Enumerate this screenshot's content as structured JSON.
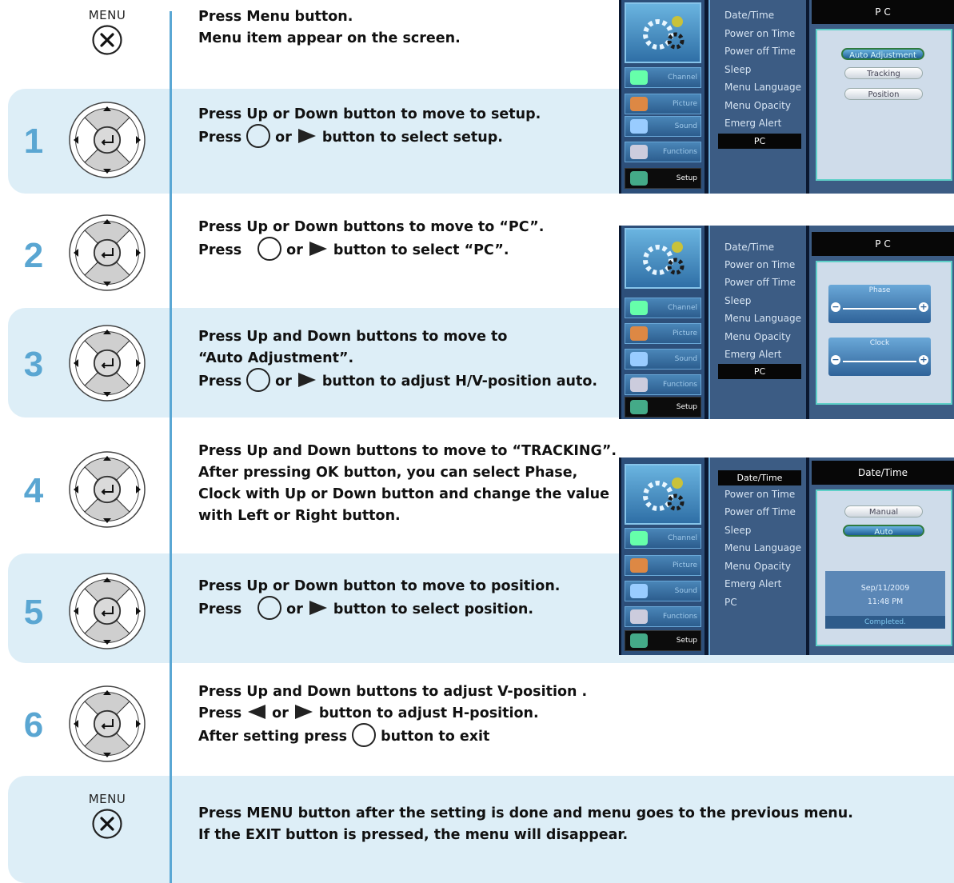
{
  "menu_label": "MENU",
  "intro": {
    "line1": "Press Menu button.",
    "line2": "Menu item appear on the screen."
  },
  "steps": [
    {
      "num": "1",
      "line1": "Press Up or Down button to move to setup.",
      "l2a": "Press",
      "l2b": "or",
      "l2c": "button to select setup."
    },
    {
      "num": "2",
      "line1": "Press Up or Down buttons to move to “PC”.",
      "l2a": "Press",
      "l2b": "or",
      "l2c": "button to select “PC”."
    },
    {
      "num": "3",
      "line1": "Press Up and Down buttons to move to",
      "line2": "“Auto Adjustment”.",
      "l3a": "Press",
      "l3b": "or",
      "l3c": "button to adjust H/V-position auto."
    },
    {
      "num": "4",
      "line1": "Press Up and Down buttons to move to “TRACKING”.",
      "line2": "After pressing  OK button, you can  select Phase,",
      "line3": "Clock with Up or Down button and change the value",
      "line4": "with Left or  Right button."
    },
    {
      "num": "5",
      "line1": "Press Up or Down button to move to position.",
      "l2a": "Press",
      "l2b": "or",
      "l2c": "button to select position."
    },
    {
      "num": "6",
      "line1": "Press Up and Down buttons to adjust V-position .",
      "l2a": "Press",
      "l2b": "or",
      "l2c": "button to adjust H-position.",
      "l3a": "After setting press",
      "l3b": "button to exit"
    }
  ],
  "final": {
    "line1": "Press MENU button after the setting is done and menu goes to the previous menu.",
    "line2": "If the EXIT button is pressed, the menu will disappear."
  },
  "osd": {
    "categories": [
      "Channel",
      "Picture",
      "Sound",
      "Functions",
      "Setup"
    ],
    "items": [
      "Date/Time",
      "Power on Time",
      "Power off Time",
      "Sleep",
      "Menu Language",
      "Menu Opacity",
      "Emerg Alert",
      "PC"
    ],
    "panel1": {
      "title": "P C",
      "options": [
        "Auto Adjustment",
        "Tracking",
        "Position"
      ]
    },
    "panel2": {
      "title": "P C",
      "sliders": [
        "Phase",
        "Clock"
      ]
    },
    "panel3": {
      "title": "Date/Time",
      "options": [
        "Manual",
        "Auto"
      ],
      "date": "Sep/11/2009",
      "time": "11:48 PM",
      "status": "Completed."
    }
  },
  "colors": {
    "band": "#ddeef7",
    "step_number": "#5aa6d2",
    "rule": "#5aa7d4",
    "osd_dark": "#0b1830",
    "osd_panel": "#3c5c84"
  }
}
